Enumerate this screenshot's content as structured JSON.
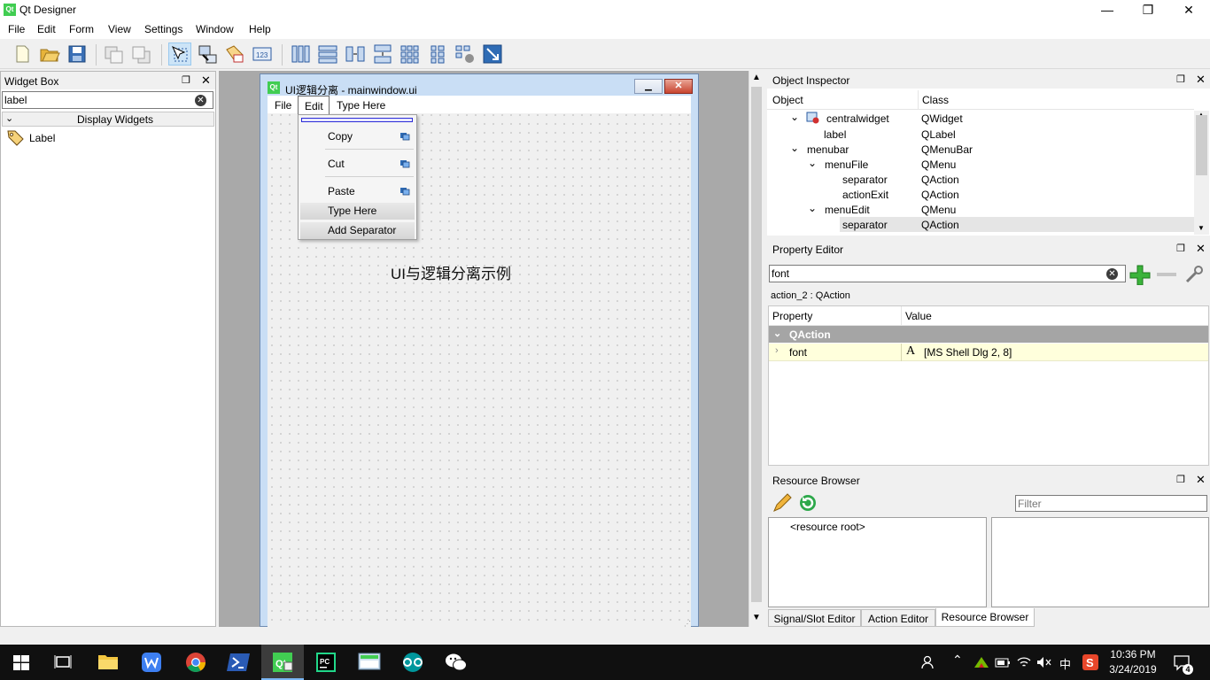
{
  "app": {
    "title": "Qt Designer",
    "icon_label": "Qt",
    "window_controls": {
      "minimize": "—",
      "restore": "❐",
      "close": "✕"
    }
  },
  "menubar": [
    "File",
    "Edit",
    "Form",
    "View",
    "Settings",
    "Window",
    "Help"
  ],
  "toolbar": {
    "icons": [
      "new-form-icon",
      "open-form-icon",
      "save-form-icon",
      "send-to-back-icon",
      "bring-to-front-icon",
      "edit-widgets-icon",
      "edit-signals-slots-icon",
      "edit-buddies-icon",
      "edit-tab-order-icon",
      "layout-horizontally-icon",
      "layout-vertically-icon",
      "layout-h-splitter-icon",
      "layout-v-splitter-icon",
      "layout-grid-icon",
      "layout-form-icon",
      "break-layout-icon",
      "adjust-size-icon"
    ]
  },
  "widget_box": {
    "title": "Widget Box",
    "filter_value": "label",
    "category": "Display Widgets",
    "items": [
      {
        "label": "Label",
        "icon": "tag-icon"
      }
    ]
  },
  "form_window": {
    "title": "UI逻辑分离 - mainwindow.ui",
    "menus": [
      "File",
      "Edit",
      "Type Here"
    ],
    "edit_menu": {
      "items": [
        {
          "label": "Copy"
        },
        {
          "label": "Cut"
        },
        {
          "label": "Paste"
        },
        {
          "label": "Type Here"
        },
        {
          "label": "Add Separator"
        }
      ]
    },
    "label_text": "UI与逻辑分离示例"
  },
  "object_inspector": {
    "title": "Object Inspector",
    "columns": [
      "Object",
      "Class"
    ],
    "rows": [
      {
        "object": "centralwidget",
        "class": "QWidget",
        "expander": "⌄"
      },
      {
        "object": "label",
        "class": "QLabel",
        "expander": ""
      },
      {
        "object": "menubar",
        "class": "QMenuBar",
        "expander": "⌄"
      },
      {
        "object": "menuFile",
        "class": "QMenu",
        "expander": "⌄"
      },
      {
        "object": "separator",
        "class": "QAction",
        "expander": ""
      },
      {
        "object": "actionExit",
        "class": "QAction",
        "expander": ""
      },
      {
        "object": "menuEdit",
        "class": "QMenu",
        "expander": "⌄"
      },
      {
        "object": "separator",
        "class": "QAction",
        "expander": ""
      }
    ]
  },
  "property_editor": {
    "title": "Property Editor",
    "filter_value": "font",
    "context": "action_2 : QAction",
    "columns": [
      "Property",
      "Value"
    ],
    "group": "QAction",
    "rows": [
      {
        "property": "font",
        "value": "[MS Shell Dlg 2, 8]",
        "value_icon": "A"
      }
    ]
  },
  "resource_browser": {
    "title": "Resource Browser",
    "filter_placeholder": "Filter",
    "root": "<resource root>"
  },
  "bottom_tabs": [
    "Signal/Slot Editor",
    "Action Editor",
    "Resource Browser"
  ],
  "taskbar": {
    "time": "10:36 PM",
    "date": "3/24/2019",
    "ime": "中",
    "notification_count": "4",
    "apps": [
      "task-view-icon",
      "file-explorer-icon",
      "wps-icon",
      "chrome-icon",
      "powershell-icon",
      "qt-designer-icon",
      "pycharm-icon",
      "qt-app-icon",
      "arduino-icon",
      "wechat-icon"
    ]
  },
  "colors": {
    "accent": "#41cd52",
    "selection": "#cce4f7",
    "group_header": "#a5a5a5",
    "property_row": "#ffffdc",
    "taskbar": "#101010"
  }
}
